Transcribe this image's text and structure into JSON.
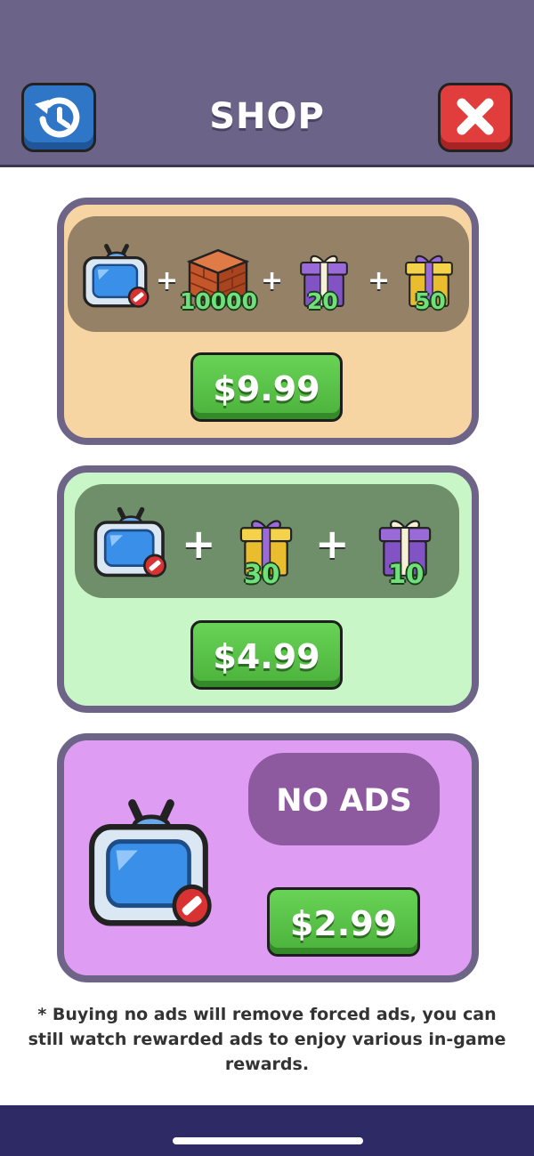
{
  "header": {
    "title": "SHOP",
    "restore_icon": "restore-history-icon",
    "close_icon": "close-x-icon",
    "bg_color": "#6c6389"
  },
  "bundles": [
    {
      "bg_color": "#f6d5a2",
      "items": [
        {
          "icon": "no-ads-tv-icon",
          "quantity": ""
        },
        {
          "icon": "brick-block-icon",
          "quantity": "10000"
        },
        {
          "icon": "purple-gift-icon",
          "quantity": "20"
        },
        {
          "icon": "yellow-gift-icon",
          "quantity": "50"
        }
      ],
      "plus": "+",
      "price": "$9.99"
    },
    {
      "bg_color": "#c8f6c6",
      "items": [
        {
          "icon": "no-ads-tv-icon",
          "quantity": ""
        },
        {
          "icon": "yellow-gift-icon",
          "quantity": "30"
        },
        {
          "icon": "purple-gift-icon",
          "quantity": "10"
        }
      ],
      "plus": "+",
      "price": "$4.99"
    },
    {
      "bg_color": "#df9cf3",
      "items": [
        {
          "icon": "no-ads-tv-icon",
          "quantity": ""
        }
      ],
      "label": "NO ADS",
      "price": "$2.99"
    }
  ],
  "footnote": "* Buying no ads will remove forced ads, you can still watch rewarded ads to enjoy various in-game rewards.",
  "colors": {
    "price_button": "#4bb13b",
    "card_border": "#6e6488",
    "quantity_text": "#6fe07a"
  }
}
